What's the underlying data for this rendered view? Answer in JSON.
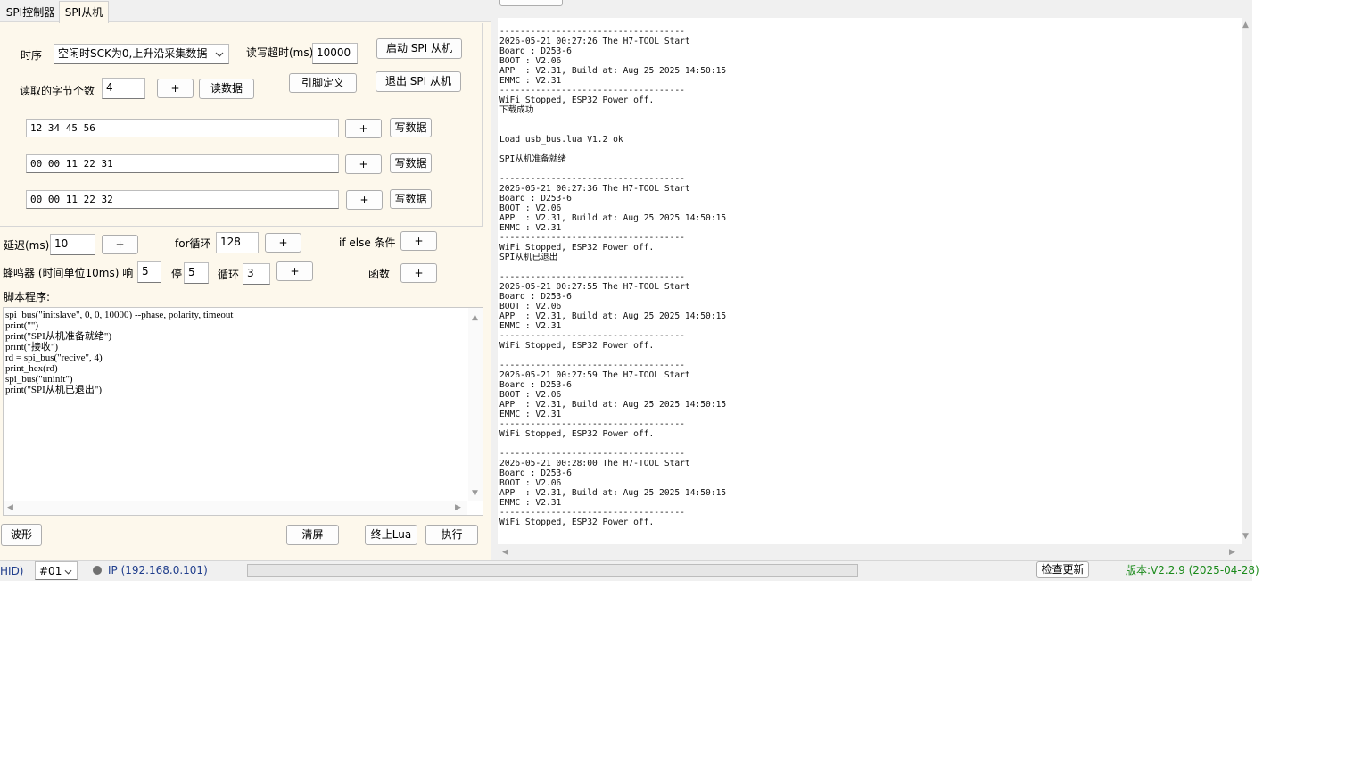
{
  "tabs": [
    "SPI控制器",
    "SPI从机"
  ],
  "config": {
    "timing_label": "时序",
    "timing_value": "空闲时SCK为0,上升沿采集数据",
    "timeout_label": "读写超时(ms)",
    "timeout_value": "10000",
    "start_button": "启动 SPI 从机",
    "bytes_label": "读取的字节个数",
    "bytes_value": "4",
    "plus": "+",
    "read_button": "读数据",
    "pin_button": "引脚定义",
    "exit_button": "退出 SPI 从机"
  },
  "write_rows": [
    {
      "value": "12 34 45 56",
      "plus": "+",
      "button": "写数据"
    },
    {
      "value": "00 00 11 22 31",
      "plus": "+",
      "button": "写数据"
    },
    {
      "value": "00 00 11 22 32",
      "plus": "+",
      "button": "写数据"
    }
  ],
  "script_tools": {
    "delay_label": "延迟(ms)",
    "delay_value": "10",
    "for_label": "for循环",
    "for_value": "128",
    "ifelse_label": "if else 条件",
    "beep_label": "蜂鸣器 (时间单位10ms) 响",
    "beep_on": "5",
    "stop_label": "停",
    "beep_off": "5",
    "loop_label": "循环",
    "loop_value": "3",
    "func_label": "函数",
    "plus": "+"
  },
  "script": {
    "label": "脚本程序:",
    "code": "spi_bus(\"initslave\", 0, 0, 10000) --phase, polarity, timeout\nprint(\"\")\nprint(\"SPI从机准备就绪\")\nprint(\"接收\")\nrd = spi_bus(\"recive\", 4)\nprint_hex(rd)\nspi_bus(\"uninit\")\nprint(\"SPI从机已退出\")"
  },
  "bottom_buttons": {
    "wave": "波形",
    "clear": "清屏",
    "stop_lua": "终止Lua",
    "run": "执行"
  },
  "console_text": "------------------------------------\n2026-05-21 00:27:26 The H7-TOOL Start\nBoard : D253-6\nBOOT : V2.06\nAPP  : V2.31, Build at: Aug 25 2025 14:50:15\nEMMC : V2.31\n------------------------------------\nWiFi Stopped, ESP32 Power off.\n下载成功\n\n\nLoad usb_bus.lua V1.2 ok\n\nSPI从机准备就绪\n\n------------------------------------\n2026-05-21 00:27:36 The H7-TOOL Start\nBoard : D253-6\nBOOT : V2.06\nAPP  : V2.31, Build at: Aug 25 2025 14:50:15\nEMMC : V2.31\n------------------------------------\nWiFi Stopped, ESP32 Power off.\nSPI从机已退出\n\n------------------------------------\n2026-05-21 00:27:55 The H7-TOOL Start\nBoard : D253-6\nBOOT : V2.06\nAPP  : V2.31, Build at: Aug 25 2025 14:50:15\nEMMC : V2.31\n------------------------------------\nWiFi Stopped, ESP32 Power off.\n\n------------------------------------\n2026-05-21 00:27:59 The H7-TOOL Start\nBoard : D253-6\nBOOT : V2.06\nAPP  : V2.31, Build at: Aug 25 2025 14:50:15\nEMMC : V2.31\n------------------------------------\nWiFi Stopped, ESP32 Power off.\n\n------------------------------------\n2026-05-21 00:28:00 The H7-TOOL Start\nBoard : D253-6\nBOOT : V2.06\nAPP  : V2.31, Build at: Aug 25 2025 14:50:15\nEMMC : V2.31\n------------------------------------\nWiFi Stopped, ESP32 Power off.",
  "status": {
    "hid": "HID)",
    "device": "#01",
    "ip": "IP (192.168.0.101)",
    "check_update": "检查更新",
    "version": "版本:V2.2.9 (2025-04-28)"
  },
  "colors": {
    "panel_bg": "#fdf8ec",
    "ip_text": "#1f3d8c",
    "version_text": "#1a8a1a",
    "status_dot": "#707070"
  }
}
